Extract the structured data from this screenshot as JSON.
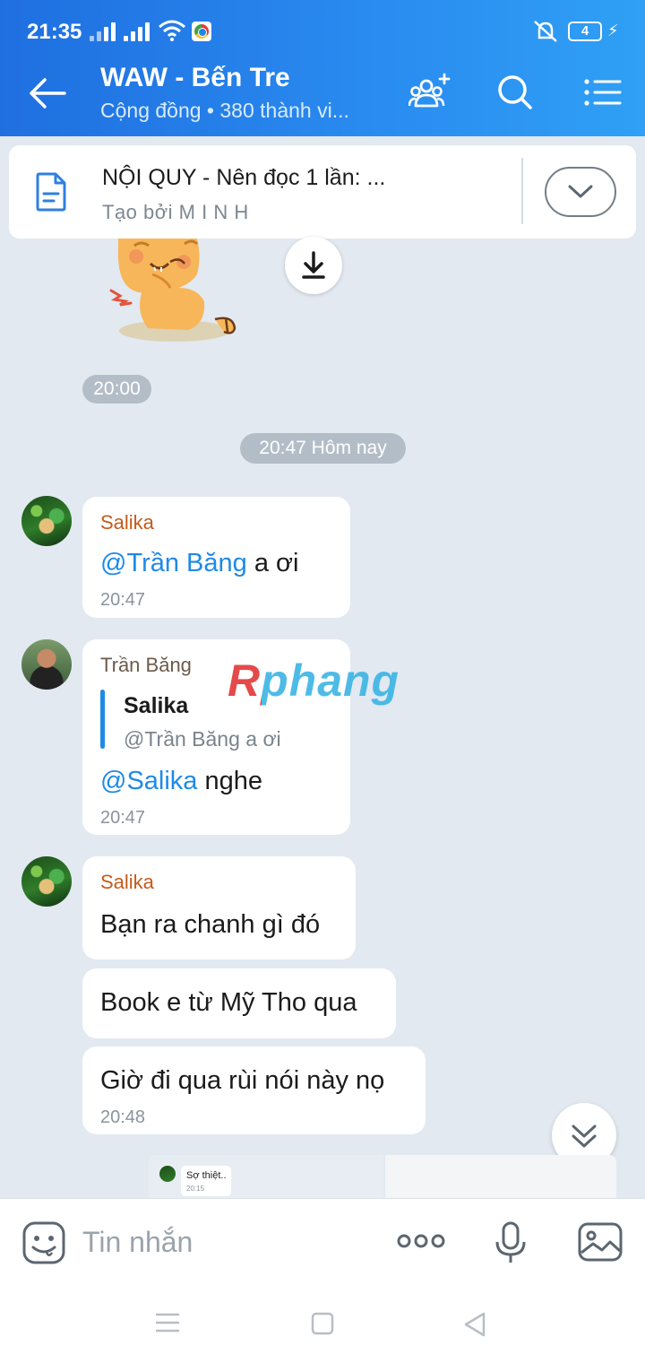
{
  "status": {
    "time": "21:35",
    "battery": "4"
  },
  "header": {
    "title": "WAW - Bến Tre",
    "subtitle": "Cộng đồng • 380 thành vi..."
  },
  "pinned": {
    "title": "NỘI QUY - Nên đọc 1 lần: ...",
    "author": "Tạo bởi M I N H"
  },
  "separators": {
    "time_sticker": "20:00",
    "date": "20:47 Hôm nay"
  },
  "messages": [
    {
      "sender": "Salika",
      "mention": "@Trần Băng",
      "text": " a ơi",
      "time": "20:47"
    },
    {
      "sender": "Trần Băng",
      "quote_sender": "Salika",
      "quote_text": "@Trần Băng a ơi",
      "mention": "@Salika",
      "text": " nghe",
      "time": "20:47"
    },
    {
      "sender": "Salika",
      "lines": [
        "Bạn ra chanh gì đó",
        "Book e từ Mỹ Tho qua",
        "Giờ đi qua rùi nói này nọ"
      ],
      "time": "20:48"
    }
  ],
  "watermark": "Rphang",
  "preview": {
    "text": "Sợ thiệt..",
    "time": "20:15"
  },
  "input": {
    "placeholder": "Tin nhắn"
  },
  "colors": {
    "header_start": "#1f6fe0",
    "header_end": "#2fa0f5",
    "background": "#e2e9f1",
    "mention": "#1f8ae6",
    "sender": "#c65a1a"
  }
}
